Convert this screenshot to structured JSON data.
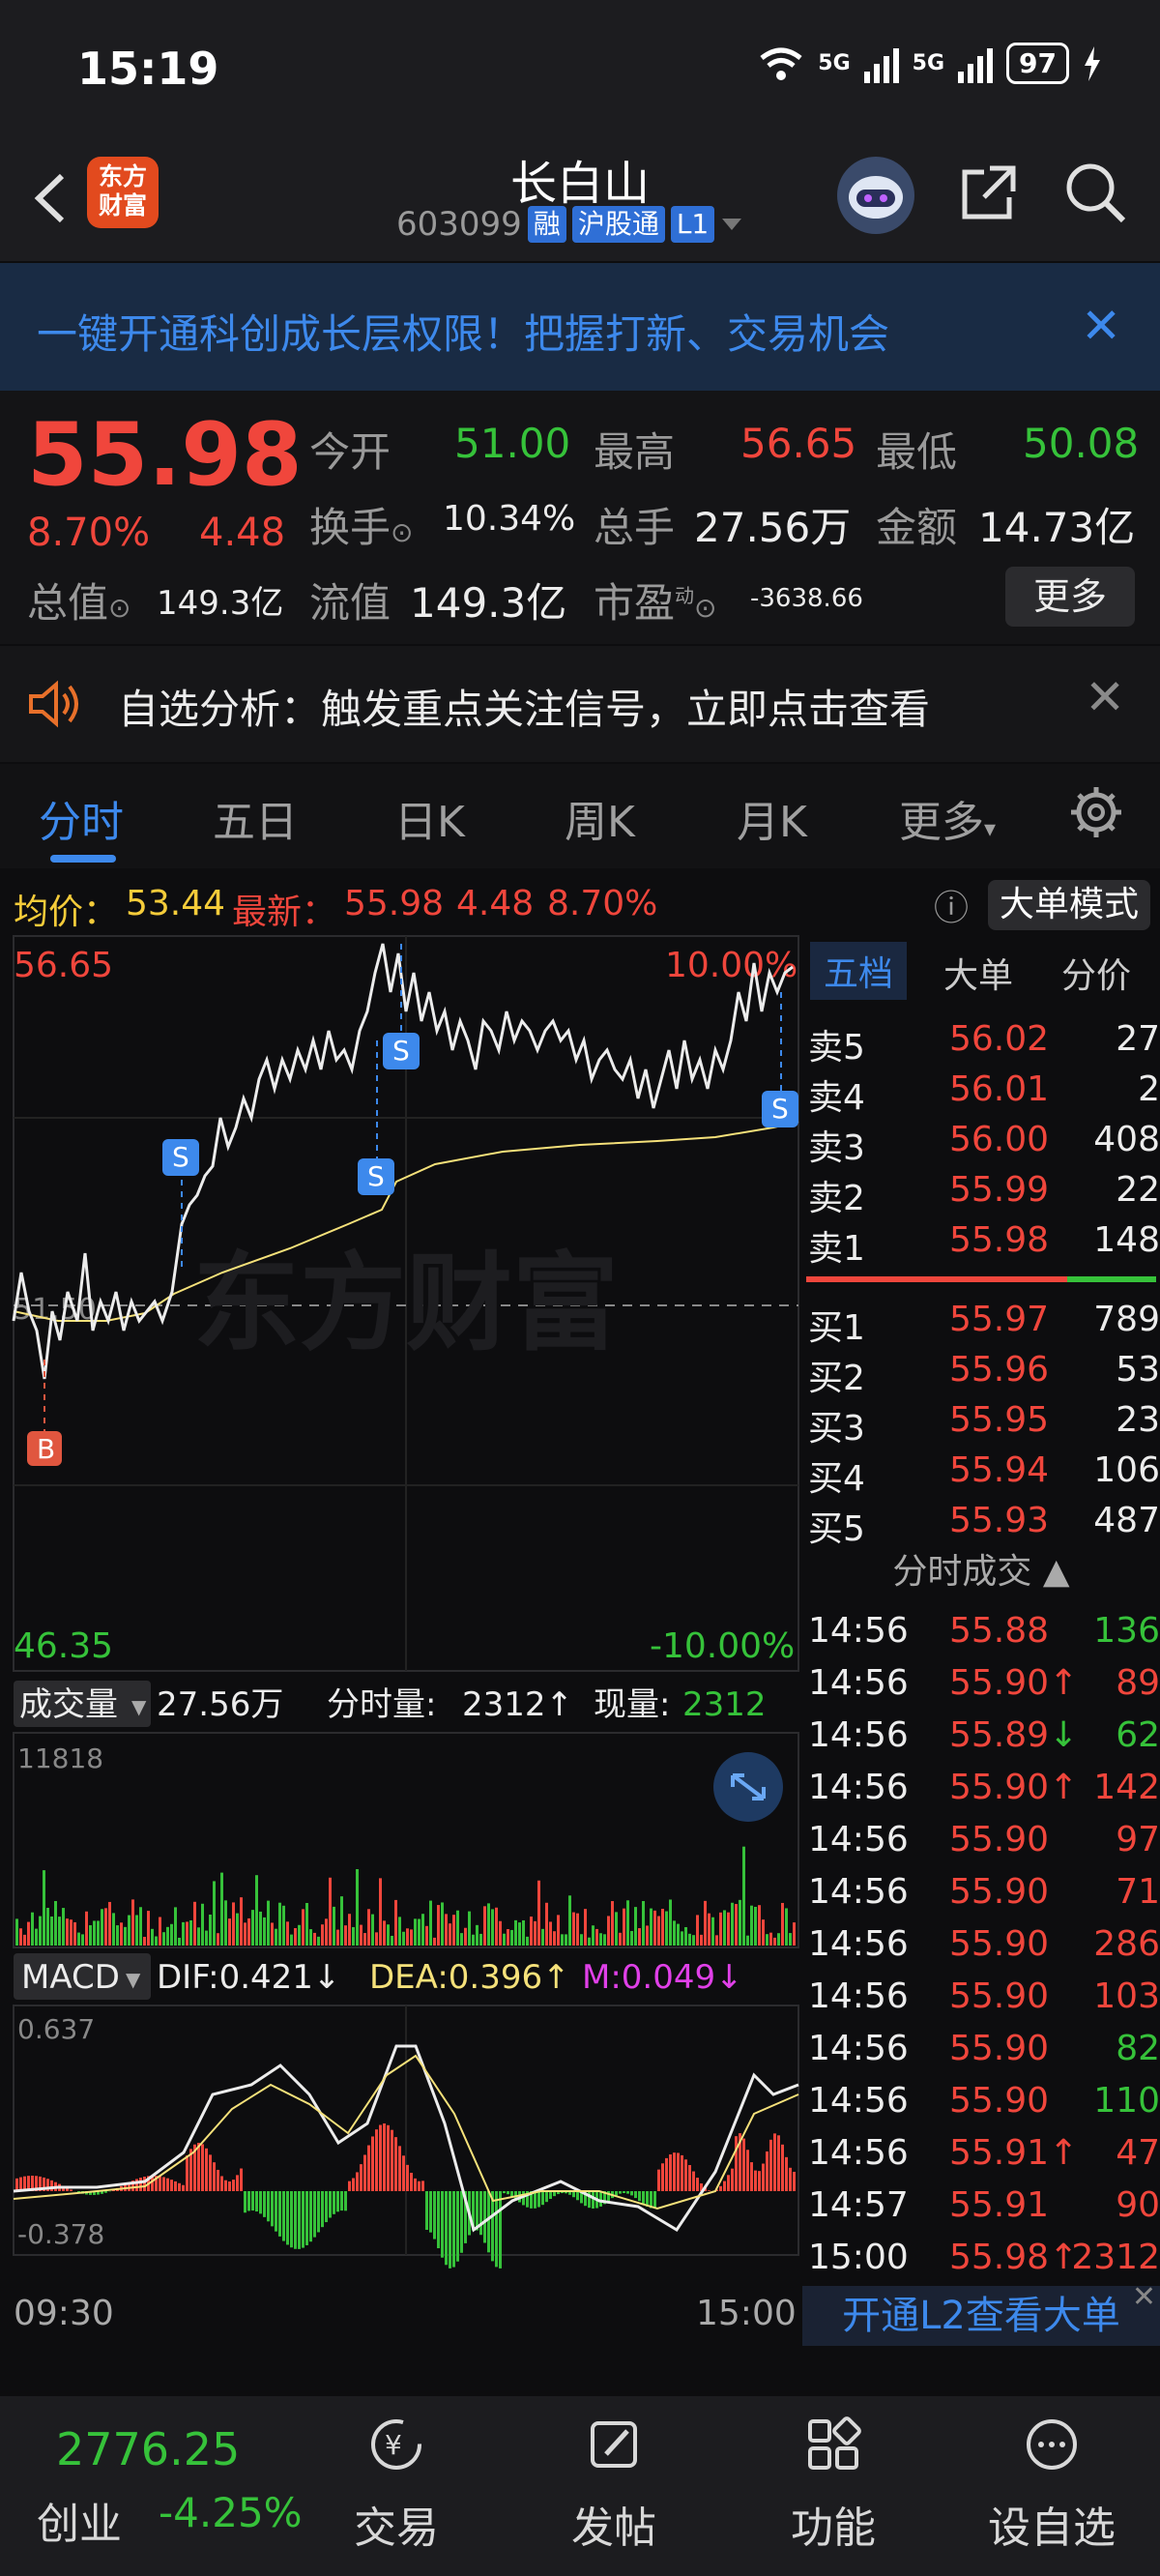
{
  "status_bar": {
    "time": "15:19",
    "network1": "5G",
    "network2": "5G",
    "battery": "97"
  },
  "header": {
    "title": "长白山",
    "code": "603099",
    "tags": [
      "融",
      "沪股通",
      "L1"
    ],
    "logo_text_1": "东方",
    "logo_text_2": "财富"
  },
  "banner": {
    "text": "一键开通科创成长层权限！把握打新、交易机会"
  },
  "quote": {
    "price": "55.98",
    "change_pct": "8.70%",
    "change": "4.48",
    "total_cap_label": "总值",
    "total_cap": "149.3亿",
    "open_label": "今开",
    "open": "51.00",
    "high_label": "最高",
    "high": "56.65",
    "low_label": "最低",
    "low": "50.08",
    "turnover_label": "换手",
    "turnover": "10.34%",
    "volume_label": "总手",
    "volume": "27.56万",
    "amount_label": "金额",
    "amount": "14.73亿",
    "float_cap_label": "流值",
    "float_cap": "149.3亿",
    "pe_label": "市盈",
    "pe_sup": "动",
    "pe": "-3638.66",
    "more_label": "更多"
  },
  "notice": {
    "text": "自选分析：触发重点关注信号，立即点击查看"
  },
  "tabs": [
    "分时",
    "五日",
    "日K",
    "周K",
    "月K",
    "更多"
  ],
  "avg_row": {
    "avg_label": "均价：",
    "avg": "53.44",
    "latest_label": "最新：",
    "latest": "55.98",
    "latest_chg": "4.48",
    "latest_pct": "8.70%",
    "mode_button": "大单模式"
  },
  "chart": {
    "top_price": "56.65",
    "top_pct": "10.00%",
    "bottom_price": "46.35",
    "bottom_pct": "-10.00%",
    "ref_price": "51.50",
    "watermark": "东方财富",
    "volume_label": "成交量",
    "volume_total": "27.56万",
    "volume_tick_label": "分时量:",
    "volume_tick": "2312↑",
    "current_vol_label": "现量:",
    "current_vol": "2312",
    "volume_max": "11818",
    "macd_label": "MACD",
    "dif": "DIF:0.421↓",
    "dea": "DEA:0.396↑",
    "m": "M:0.049↓",
    "macd_max": "0.637",
    "macd_min": "-0.378",
    "time_start": "09:30",
    "time_end": "15:00",
    "signals": [
      "B",
      "S",
      "S",
      "S",
      "S"
    ]
  },
  "right_panel": {
    "tabs": [
      "五档",
      "大单",
      "分价"
    ],
    "asks": [
      {
        "label": "卖5",
        "price": "56.02",
        "vol": "27"
      },
      {
        "label": "卖4",
        "price": "56.01",
        "vol": "2"
      },
      {
        "label": "卖3",
        "price": "56.00",
        "vol": "408"
      },
      {
        "label": "卖2",
        "price": "55.99",
        "vol": "22"
      },
      {
        "label": "卖1",
        "price": "55.98",
        "vol": "148"
      }
    ],
    "bids": [
      {
        "label": "买1",
        "price": "55.97",
        "vol": "789"
      },
      {
        "label": "买2",
        "price": "55.96",
        "vol": "53"
      },
      {
        "label": "买3",
        "price": "55.95",
        "vol": "23"
      },
      {
        "label": "买4",
        "price": "55.94",
        "vol": "106"
      },
      {
        "label": "买5",
        "price": "55.93",
        "vol": "487"
      }
    ],
    "ticks_title": "分时成交",
    "ticks": [
      {
        "time": "14:56",
        "price": "55.88",
        "dir": "",
        "vol": "136",
        "color": "green"
      },
      {
        "time": "14:56",
        "price": "55.90",
        "dir": "↑",
        "vol": "89",
        "color": "red"
      },
      {
        "time": "14:56",
        "price": "55.89",
        "dir": "↓",
        "vol": "62",
        "color": "green"
      },
      {
        "time": "14:56",
        "price": "55.90",
        "dir": "↑",
        "vol": "142",
        "color": "red"
      },
      {
        "time": "14:56",
        "price": "55.90",
        "dir": "",
        "vol": "97",
        "color": "red"
      },
      {
        "time": "14:56",
        "price": "55.90",
        "dir": "",
        "vol": "71",
        "color": "red"
      },
      {
        "time": "14:56",
        "price": "55.90",
        "dir": "",
        "vol": "286",
        "color": "red"
      },
      {
        "time": "14:56",
        "price": "55.90",
        "dir": "",
        "vol": "103",
        "color": "red"
      },
      {
        "time": "14:56",
        "price": "55.90",
        "dir": "",
        "vol": "82",
        "color": "green"
      },
      {
        "time": "14:56",
        "price": "55.90",
        "dir": "",
        "vol": "110",
        "color": "green"
      },
      {
        "time": "14:56",
        "price": "55.91",
        "dir": "↑",
        "vol": "47",
        "color": "red"
      },
      {
        "time": "14:57",
        "price": "55.91",
        "dir": "",
        "vol": "90",
        "color": "red"
      },
      {
        "time": "15:00",
        "price": "55.98",
        "dir": "↑",
        "vol": "2312",
        "color": "red"
      }
    ],
    "l2_banner": "开通L2查看大单"
  },
  "bottom_nav": {
    "index_value": "2776.25",
    "index_name": "创业",
    "index_pct": "-4.25%",
    "items": [
      "交易",
      "发帖",
      "功能",
      "设自选"
    ]
  },
  "colors": {
    "up": "#f0463c",
    "down": "#36c23a",
    "accent": "#3d89ec",
    "avg_line": "#f5e17a"
  }
}
